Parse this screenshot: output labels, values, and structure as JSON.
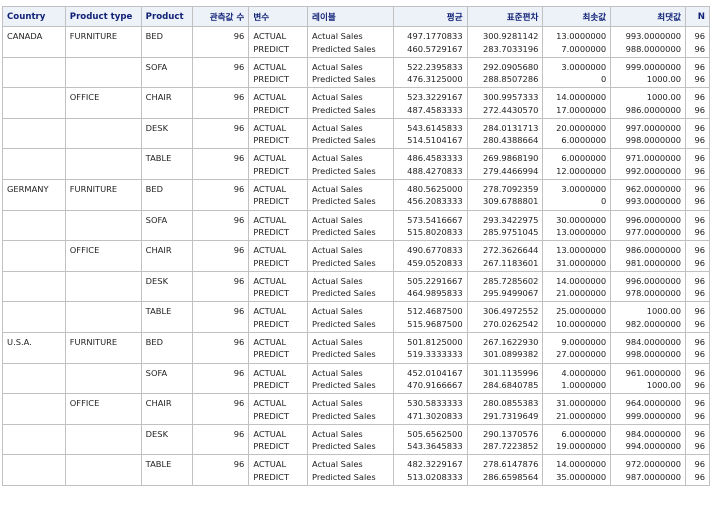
{
  "headers": [
    "Country",
    "Product type",
    "Product",
    "관측값 수",
    "변수",
    "레이블",
    "평균",
    "표준편차",
    "최솟값",
    "최댓값",
    "N"
  ],
  "variables": [
    "ACTUAL",
    "PREDICT"
  ],
  "labels": [
    "Actual Sales",
    "Predicted Sales"
  ],
  "rows": [
    {
      "country": "CANADA",
      "type": "FURNITURE",
      "product": "BED",
      "nobs": "96",
      "mean": [
        "497.1770833",
        "460.5729167"
      ],
      "std": [
        "300.9281142",
        "283.7033196"
      ],
      "min": [
        "13.0000000",
        "7.0000000"
      ],
      "max": [
        "993.0000000",
        "988.0000000"
      ],
      "n": [
        "96",
        "96"
      ]
    },
    {
      "country": "",
      "type": "",
      "product": "SOFA",
      "nobs": "96",
      "mean": [
        "522.2395833",
        "476.3125000"
      ],
      "std": [
        "292.0905680",
        "288.8507286"
      ],
      "min": [
        "3.0000000",
        "0"
      ],
      "max": [
        "999.0000000",
        "1000.00"
      ],
      "n": [
        "96",
        "96"
      ]
    },
    {
      "country": "",
      "type": "OFFICE",
      "product": "CHAIR",
      "nobs": "96",
      "mean": [
        "523.3229167",
        "487.4583333"
      ],
      "std": [
        "300.9957333",
        "272.4430570"
      ],
      "min": [
        "14.0000000",
        "17.0000000"
      ],
      "max": [
        "1000.00",
        "986.0000000"
      ],
      "n": [
        "96",
        "96"
      ]
    },
    {
      "country": "",
      "type": "",
      "product": "DESK",
      "nobs": "96",
      "mean": [
        "543.6145833",
        "514.5104167"
      ],
      "std": [
        "284.0131713",
        "280.4388664"
      ],
      "min": [
        "20.0000000",
        "6.0000000"
      ],
      "max": [
        "997.0000000",
        "998.0000000"
      ],
      "n": [
        "96",
        "96"
      ]
    },
    {
      "country": "",
      "type": "",
      "product": "TABLE",
      "nobs": "96",
      "mean": [
        "486.4583333",
        "488.4270833"
      ],
      "std": [
        "269.9868190",
        "279.4466994"
      ],
      "min": [
        "6.0000000",
        "12.0000000"
      ],
      "max": [
        "971.0000000",
        "992.0000000"
      ],
      "n": [
        "96",
        "96"
      ]
    },
    {
      "country": "GERMANY",
      "type": "FURNITURE",
      "product": "BED",
      "nobs": "96",
      "mean": [
        "480.5625000",
        "456.2083333"
      ],
      "std": [
        "278.7092359",
        "309.6788801"
      ],
      "min": [
        "3.0000000",
        "0"
      ],
      "max": [
        "962.0000000",
        "993.0000000"
      ],
      "n": [
        "96",
        "96"
      ]
    },
    {
      "country": "",
      "type": "",
      "product": "SOFA",
      "nobs": "96",
      "mean": [
        "573.5416667",
        "515.8020833"
      ],
      "std": [
        "293.3422975",
        "285.9751045"
      ],
      "min": [
        "30.0000000",
        "13.0000000"
      ],
      "max": [
        "996.0000000",
        "977.0000000"
      ],
      "n": [
        "96",
        "96"
      ]
    },
    {
      "country": "",
      "type": "OFFICE",
      "product": "CHAIR",
      "nobs": "96",
      "mean": [
        "490.6770833",
        "459.0520833"
      ],
      "std": [
        "272.3626644",
        "267.1183601"
      ],
      "min": [
        "13.0000000",
        "31.0000000"
      ],
      "max": [
        "986.0000000",
        "981.0000000"
      ],
      "n": [
        "96",
        "96"
      ]
    },
    {
      "country": "",
      "type": "",
      "product": "DESK",
      "nobs": "96",
      "mean": [
        "505.2291667",
        "464.9895833"
      ],
      "std": [
        "285.7285602",
        "295.9499067"
      ],
      "min": [
        "14.0000000",
        "21.0000000"
      ],
      "max": [
        "996.0000000",
        "978.0000000"
      ],
      "n": [
        "96",
        "96"
      ]
    },
    {
      "country": "",
      "type": "",
      "product": "TABLE",
      "nobs": "96",
      "mean": [
        "512.4687500",
        "515.9687500"
      ],
      "std": [
        "306.4972552",
        "270.0262542"
      ],
      "min": [
        "25.0000000",
        "10.0000000"
      ],
      "max": [
        "1000.00",
        "982.0000000"
      ],
      "n": [
        "96",
        "96"
      ]
    },
    {
      "country": "U.S.A.",
      "type": "FURNITURE",
      "product": "BED",
      "nobs": "96",
      "mean": [
        "501.8125000",
        "519.3333333"
      ],
      "std": [
        "267.1622930",
        "301.0899382"
      ],
      "min": [
        "9.0000000",
        "27.0000000"
      ],
      "max": [
        "984.0000000",
        "998.0000000"
      ],
      "n": [
        "96",
        "96"
      ]
    },
    {
      "country": "",
      "type": "",
      "product": "SOFA",
      "nobs": "96",
      "mean": [
        "452.0104167",
        "470.9166667"
      ],
      "std": [
        "301.1135996",
        "284.6840785"
      ],
      "min": [
        "4.0000000",
        "1.0000000"
      ],
      "max": [
        "961.0000000",
        "1000.00"
      ],
      "n": [
        "96",
        "96"
      ]
    },
    {
      "country": "",
      "type": "OFFICE",
      "product": "CHAIR",
      "nobs": "96",
      "mean": [
        "530.5833333",
        "471.3020833"
      ],
      "std": [
        "280.0855383",
        "291.7319649"
      ],
      "min": [
        "31.0000000",
        "21.0000000"
      ],
      "max": [
        "964.0000000",
        "999.0000000"
      ],
      "n": [
        "96",
        "96"
      ]
    },
    {
      "country": "",
      "type": "",
      "product": "DESK",
      "nobs": "96",
      "mean": [
        "505.6562500",
        "543.3645833"
      ],
      "std": [
        "290.1370576",
        "287.7223852"
      ],
      "min": [
        "6.0000000",
        "19.0000000"
      ],
      "max": [
        "984.0000000",
        "994.0000000"
      ],
      "n": [
        "96",
        "96"
      ]
    },
    {
      "country": "",
      "type": "",
      "product": "TABLE",
      "nobs": "96",
      "mean": [
        "482.3229167",
        "513.0208333"
      ],
      "std": [
        "278.6147876",
        "286.6598564"
      ],
      "min": [
        "14.0000000",
        "35.0000000"
      ],
      "max": [
        "972.0000000",
        "987.0000000"
      ],
      "n": [
        "96",
        "96"
      ]
    }
  ]
}
